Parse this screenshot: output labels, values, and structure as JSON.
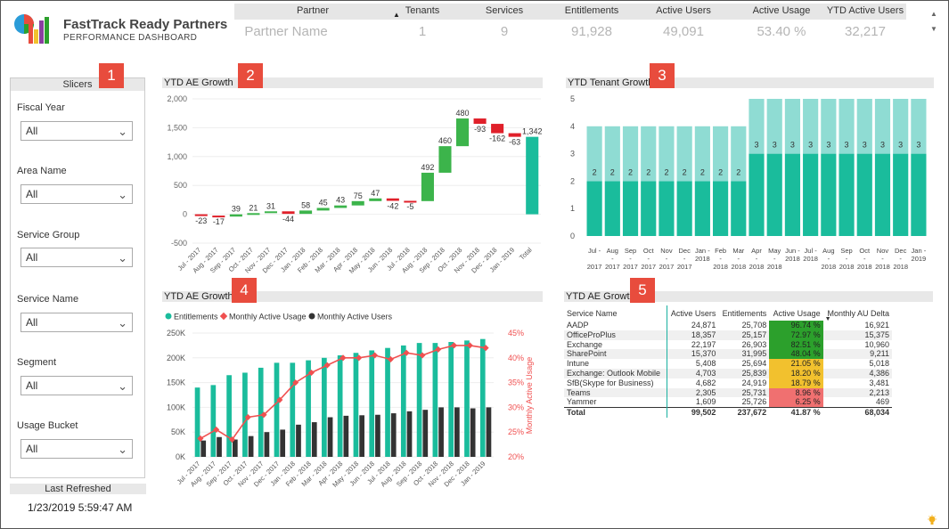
{
  "header": {
    "title": "FastTrack Ready Partners",
    "subtitle": "PERFORMANCE DASHBOARD",
    "logo_colors": [
      "#e84c3d",
      "#f2c12e",
      "#8a3fa0",
      "#2a9cd8",
      "#2ca02c"
    ]
  },
  "partner_table": {
    "columns": [
      "Partner",
      "Tenants",
      "Services",
      "Entitlements",
      "Active Users",
      "Active Usage",
      "YTD Active Users"
    ],
    "row": [
      "Partner Name",
      "1",
      "9",
      "91,928",
      "49,091",
      "53.40 %",
      "32,217"
    ],
    "sort_indicator": "▲",
    "scroll_up": "▲",
    "scroll_down": "▼"
  },
  "badges": [
    "1",
    "2",
    "3",
    "4",
    "5"
  ],
  "slicers": {
    "title": "Slicers",
    "items": [
      {
        "label": "Fiscal Year",
        "value": "All"
      },
      {
        "label": "Area Name",
        "value": "All"
      },
      {
        "label": "Service Group",
        "value": "All"
      },
      {
        "label": "Service Name",
        "value": "All"
      },
      {
        "label": "Segment",
        "value": "All"
      },
      {
        "label": "Usage Bucket",
        "value": "All"
      }
    ]
  },
  "last_refreshed": {
    "label": "Last Refreshed",
    "value": "1/23/2019 5:59:47 AM"
  },
  "visual_titles": {
    "v2": "YTD AE Growth",
    "v3": "YTD Tenant Growth",
    "v4": "YTD AE Growth",
    "v5": "YTD AE Growth"
  },
  "chart_data": [
    {
      "type": "bar",
      "subtype": "waterfall",
      "title": "YTD AE Growth",
      "categories": [
        "Jul - 2017",
        "Aug - 2017",
        "Sep - 2017",
        "Oct - 2017",
        "Nov - 2017",
        "Dec - 2017",
        "Jan - 2018",
        "Feb - 2018",
        "Mar - 2018",
        "Apr - 2018",
        "May - 2018",
        "Jun - 2018",
        "Jul - 2018",
        "Aug - 2018",
        "Sep - 2018",
        "Oct - 2018",
        "Nov - 2018",
        "Dec - 2018",
        "Jan - 2019",
        "Total"
      ],
      "values": [
        -23,
        -17,
        39,
        21,
        31,
        -44,
        58,
        45,
        43,
        75,
        47,
        -42,
        -5,
        492,
        460,
        480,
        -93,
        -162,
        -63,
        1342
      ],
      "labels": [
        "-23",
        "-17",
        "39",
        "21",
        "31",
        "-44",
        "58",
        "45",
        "43",
        "75",
        "47",
        "-42",
        "-5",
        "492",
        "460",
        "480",
        "-93",
        "-162",
        "-63",
        "1,342"
      ],
      "yticks": [
        "2,000",
        "1,500",
        "1,000",
        "500",
        "0",
        "-500"
      ],
      "ylim": [
        -500,
        2000
      ],
      "colors": {
        "increase": "#3cb44b",
        "decrease": "#e0202a",
        "total": "#1abc9c"
      }
    },
    {
      "type": "bar",
      "subtype": "stacked",
      "title": "YTD Tenant Growth",
      "categories": [
        "Jul - 2017",
        "Aug - 2017",
        "Sep - 2017",
        "Oct - 2017",
        "Nov - 2017",
        "Dec - 2017",
        "Jan - 2018",
        "Feb - 2018",
        "Mar - 2018",
        "Apr - 2018",
        "May - 2018",
        "Jun - 2018",
        "Jul - 2018",
        "Aug - 2018",
        "Sep - 2018",
        "Oct - 2018",
        "Nov - 2018",
        "Dec - 2018",
        "Jan - 2019"
      ],
      "x_top": [
        "Jul -",
        "Aug",
        "Sep",
        "Oct",
        "Nov",
        "Dec",
        "Jan -",
        "Feb",
        "Mar",
        "Apr",
        "May",
        "Jun -",
        "Jul -",
        "Aug",
        "Sep",
        "Oct",
        "Nov",
        "Dec",
        "Jan -"
      ],
      "x_mid": [
        "",
        "-",
        "-",
        "-",
        "-",
        "-",
        "2018",
        "-",
        "-",
        "-",
        "-",
        "2018",
        "2018",
        "-",
        "-",
        "-",
        "-",
        "-",
        "2019"
      ],
      "x_bot": [
        "2017",
        "2017",
        "2017",
        "2017",
        "2017",
        "2017",
        "",
        "2018",
        "2018",
        "2018",
        "2018",
        "",
        "",
        "2018",
        "2018",
        "2018",
        "2018",
        "2018",
        ""
      ],
      "series": [
        {
          "values": [
            2,
            2,
            2,
            2,
            2,
            2,
            2,
            2,
            2,
            3,
            3,
            3,
            3,
            3,
            3,
            3,
            3,
            3,
            3
          ]
        },
        {
          "values": [
            2,
            2,
            2,
            2,
            2,
            2,
            2,
            2,
            2,
            2,
            2,
            2,
            2,
            2,
            2,
            2,
            2,
            2,
            2
          ]
        }
      ],
      "labels": [
        [
          "2",
          "2",
          "2",
          "2",
          "2",
          "2",
          "2",
          "2",
          "2",
          "3",
          "3",
          "3",
          "3",
          "3",
          "3",
          "3",
          "3",
          "3",
          "3"
        ]
      ],
      "yticks": [
        "5",
        "4",
        "3",
        "2",
        "1",
        "0"
      ],
      "ylim": [
        0,
        5
      ],
      "colors": [
        "#1abc9c",
        "#8fdcd3"
      ]
    },
    {
      "type": "bar",
      "subtype": "combo",
      "title": "YTD AE Growth",
      "categories": [
        "Jul - 2017",
        "Aug - 2017",
        "Sep - 2017",
        "Oct - 2017",
        "Nov - 2017",
        "Dec - 2017",
        "Jan - 2018",
        "Feb - 2018",
        "Mar - 2018",
        "Apr - 2018",
        "May - 2018",
        "Jun - 2018",
        "Jul - 2018",
        "Aug - 2018",
        "Sep - 2018",
        "Oct - 2018",
        "Nov - 2018",
        "Dec - 2018",
        "Jan - 2019"
      ],
      "series": [
        {
          "name": "Entitlements",
          "type": "bar",
          "color": "#1abc9c",
          "values": [
            140000,
            145000,
            165000,
            170000,
            180000,
            190000,
            190000,
            195000,
            200000,
            205000,
            210000,
            215000,
            220000,
            225000,
            230000,
            230000,
            232000,
            235000,
            238000
          ]
        },
        {
          "name": "Monthly Active Users",
          "type": "bar",
          "color": "#333333",
          "values": [
            33000,
            40000,
            35000,
            42000,
            50000,
            55000,
            65000,
            70000,
            80000,
            83000,
            84000,
            85000,
            88000,
            92000,
            95000,
            100000,
            100000,
            98000,
            100000
          ]
        },
        {
          "name": "Monthly Active Usage",
          "type": "line",
          "color": "#f05050",
          "axis": "right",
          "values": [
            0.237,
            0.255,
            0.235,
            0.28,
            0.285,
            0.315,
            0.35,
            0.37,
            0.385,
            0.4,
            0.4,
            0.405,
            0.397,
            0.41,
            0.405,
            0.417,
            0.425,
            0.425,
            0.42
          ]
        }
      ],
      "yticks": [
        "250K",
        "200K",
        "150K",
        "100K",
        "50K",
        "0K"
      ],
      "ylim": [
        0,
        250000
      ],
      "y2ticks": [
        "45%",
        "40%",
        "35%",
        "30%",
        "25%",
        "20%"
      ],
      "y2lim": [
        0.2,
        0.45
      ],
      "y2label": "Monthly Active Usage",
      "legend": [
        "Entitlements",
        "Monthly Active Usage",
        "Monthly Active Users"
      ]
    },
    {
      "type": "table",
      "title": "YTD AE Growth",
      "columns": [
        "Service Name",
        "Active Users",
        "Entitlements",
        "Active Usage",
        "Monthly AU Delta"
      ],
      "rows": [
        [
          "AADP",
          "24,871",
          "25,708",
          "96.74 %",
          "16,921"
        ],
        [
          "OfficeProPlus",
          "18,357",
          "25,157",
          "72.97 %",
          "15,375"
        ],
        [
          "Exchange",
          "22,197",
          "26,903",
          "82.51 %",
          "10,960"
        ],
        [
          "SharePoint",
          "15,370",
          "31,995",
          "48.04 %",
          "9,211"
        ],
        [
          "Intune",
          "5,408",
          "25,694",
          "21.05 %",
          "5,018"
        ],
        [
          "Exchange: Outlook Mobile",
          "4,703",
          "25,839",
          "18.20 %",
          "4,386"
        ],
        [
          "SfB(Skype for Business)",
          "4,682",
          "24,919",
          "18.79 %",
          "3,481"
        ],
        [
          "Teams",
          "2,305",
          "25,731",
          "8.96 %",
          "2,213"
        ],
        [
          "Yammer",
          "1,609",
          "25,726",
          "6.25 %",
          "469"
        ]
      ],
      "total": [
        "Total",
        "99,502",
        "237,672",
        "41.87 %",
        "68,034"
      ],
      "usage_heat": [
        "green",
        "green",
        "green",
        "green",
        "yellow",
        "yellow",
        "yellow",
        "red",
        "red"
      ],
      "sort_indicator": "▼"
    }
  ]
}
